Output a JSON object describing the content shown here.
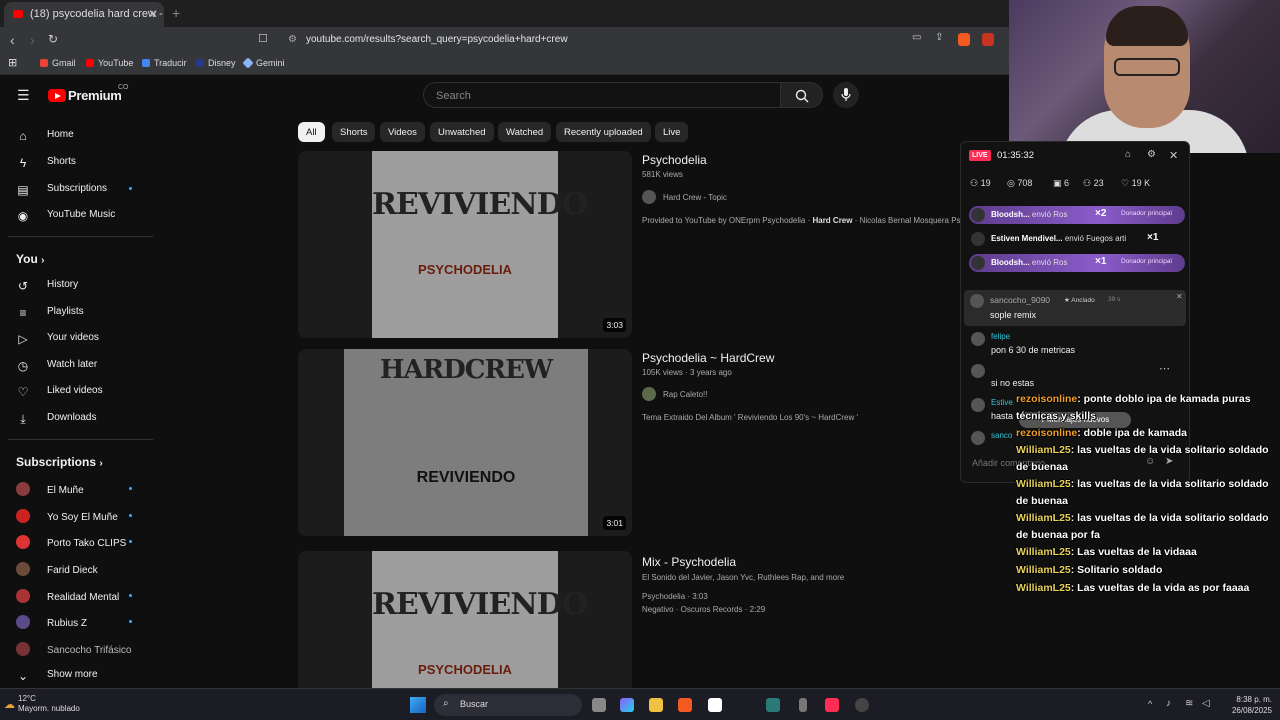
{
  "browser": {
    "tab_title": "(18) psycodelia hard crew - YouTube",
    "url": "youtube.com/results?search_query=psycodelia+hard+crew",
    "bookmarks": [
      "Gmail",
      "YouTube",
      "Traducir",
      "Disney",
      "Gemini"
    ]
  },
  "header": {
    "logo": "Premium",
    "region": "CO",
    "search_placeholder": "Search"
  },
  "sidebar": {
    "main": [
      "Home",
      "Shorts",
      "Subscriptions",
      "YouTube Music"
    ],
    "you_title": "You",
    "you": [
      "History",
      "Playlists",
      "Your videos",
      "Watch later",
      "Liked videos",
      "Downloads"
    ],
    "subs_title": "Subscriptions",
    "subs": [
      "El Muñe",
      "Yo Soy El Muñe",
      "Porto Tako CLIPS",
      "Farid Dieck",
      "Realidad Mental",
      "Rubius Z",
      "Sancocho Trifásico"
    ],
    "show_more": "Show more"
  },
  "chips": [
    "All",
    "Shorts",
    "Videos",
    "Unwatched",
    "Watched",
    "Recently uploaded",
    "Live"
  ],
  "results": [
    {
      "title": "Psychodelia",
      "meta": "581K views",
      "channel": "Hard Crew - Topic",
      "desc_pre": "Provided to YouTube by ONErpm Psychodelia · ",
      "desc_bold": "Hard Crew",
      "desc_post": " · Nicolas Bernal Mosquera Psych",
      "duration": "3:03",
      "art_big": "REVIVIENDO",
      "art_small": "PSYCHODELIA"
    },
    {
      "title": "Psychodelia ~ HardCrew",
      "meta": "105K views · 3 years ago",
      "channel": "Rap Caleto!!",
      "desc": "Tema Extraido Del Album ' Reviviendo Los 90's ~ HardCrew '",
      "duration": "3:01",
      "art_big": "HARDCREW",
      "art_small": "REVIVIENDO"
    },
    {
      "title": "Mix - Psychodelia",
      "meta": "El Sonido del Javier, Jason Yvc, Ruthlees Rap, and more",
      "line1": "Psychodelia · 3:03",
      "line2": "Negativo · Oscuros Records · 2:29",
      "art_big": "REVIVIENDO",
      "art_small": "PSYCHODELIA"
    }
  ],
  "live": {
    "badge": "LIVE",
    "time": "01:35:32",
    "stats": [
      "19",
      "708",
      "6",
      "23",
      "19 K"
    ],
    "gifts": [
      {
        "name": "Bloodsh...",
        "action": "envió Ros",
        "count": "×2",
        "tag": "Donador principal"
      },
      {
        "name": "Estiven Mendivel...",
        "action": "envió Fuegos arti",
        "count": "×1",
        "tag": ""
      },
      {
        "name": "Bloodsh...",
        "action": "envió Ros",
        "count": "×1",
        "tag": "Donador principal"
      }
    ],
    "pinned": {
      "user": "sancocho_9090",
      "label": "Anclado",
      "age": "39 s",
      "text": "sople remix"
    },
    "comments": [
      {
        "user": "felipe",
        "text": "pon 6 30 de metricas"
      },
      {
        "user": "",
        "text": "si no estas"
      },
      {
        "user": "Estive",
        "text": "hasta"
      },
      {
        "user": "sanco",
        "text": ""
      }
    ],
    "new_messages": "Mensajes nuevos",
    "input_placeholder": "Añadir comentario..."
  },
  "overlay_chat": [
    {
      "user": "rezoisonline",
      "text": ": ponte doblo ipa de kamada puras técnicas y skills",
      "cls": "u1"
    },
    {
      "user": "rezoisonline",
      "text": ": doble ipa de kamada",
      "cls": "u1"
    },
    {
      "user": "WilliamL25",
      "text": ": las vueltas de la vida solitario soldado de buenaa",
      "cls": "u2"
    },
    {
      "user": "WilliamL25",
      "text": ": las vueltas de la vida solitario soldado de buenaa",
      "cls": "u2"
    },
    {
      "user": "WilliamL25",
      "text": ": las vueltas de la vida solitario soldado de buenaa por fa",
      "cls": "u2"
    },
    {
      "user": "WilliamL25",
      "text": ": Las vueltas de la vidaaa",
      "cls": "u2"
    },
    {
      "user": "WilliamL25",
      "text": ": Solitario soldado",
      "cls": "u2"
    },
    {
      "user": "WilliamL25",
      "text": ": Las vueltas de la vida as por faaaa",
      "cls": "u2"
    }
  ],
  "taskbar": {
    "temp": "12°C",
    "weather": "Mayorm. nublado",
    "search": "Buscar",
    "time": "8:38 p. m.",
    "date": "26/08/2025"
  }
}
